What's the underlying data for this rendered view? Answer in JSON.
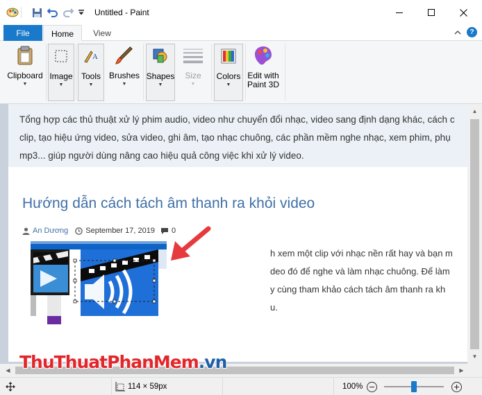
{
  "window": {
    "title": "Untitled - Paint",
    "minimize_icon": "minimize-icon",
    "maximize_icon": "maximize-icon",
    "close_icon": "close-icon"
  },
  "quick_access": {
    "save_icon": "save-icon",
    "undo_icon": "undo-icon",
    "redo_icon": "redo-icon",
    "customize_icon": "dropdown-icon"
  },
  "tabs": [
    {
      "label": "File"
    },
    {
      "label": "Home"
    },
    {
      "label": "View"
    }
  ],
  "ribbon": {
    "groups": [
      {
        "label": "Clipboard",
        "icon": "clipboard-icon"
      },
      {
        "label": "Image",
        "icon": "select-icon"
      },
      {
        "label": "Tools",
        "icon": "tools-icon"
      },
      {
        "label": "Brushes",
        "icon": "brush-icon"
      },
      {
        "label": "Shapes",
        "icon": "shapes-icon"
      },
      {
        "label": "Size",
        "icon": "size-icon"
      },
      {
        "label": "Colors",
        "icon": "colors-icon"
      },
      {
        "label": "Edit with",
        "label2": "Paint 3D",
        "icon": "paint3d-icon"
      }
    ],
    "collapse_icon": "chevron-up-icon",
    "help_icon": "help-icon"
  },
  "canvas": {
    "intro_lines": [
      "Tổng hợp các thủ thuật xử lý phim audio, video như chuyển đổi nhạc, video sang định dạng khác, cách c",
      "clip, tạo hiệu ứng video, sửa video, ghi âm, tạo nhạc chuông, các phần mềm nghe nhạc, xem phim, phụ",
      "mp3... giúp người dùng nâng cao hiệu quả công việc khi xử lý video."
    ],
    "article_title": "Hướng dẫn cách tách âm thanh ra khỏi video",
    "author": "An Dương",
    "date": "September 17, 2019",
    "comments": "0",
    "body_lines": [
      "h xem một clip với nhạc nền rất hay và bạn m",
      "deo đó để nghe và làm nhạc chuông. Để làm",
      "y cùng tham khảo cách tách âm thanh ra kh",
      "u."
    ]
  },
  "status": {
    "selection_icon": "selection-size-icon",
    "selection_size": "114 × 59px",
    "zoom": "100%",
    "zoom_level": 0.5,
    "move_icon": "move-icon"
  },
  "watermark": {
    "part1": "ThuThuat",
    "part2": "PhanMem",
    "part3": ".vn"
  },
  "colors": {
    "accent": "#1979ca",
    "link": "#3f6fa8",
    "arrow": "#e63a3f"
  }
}
